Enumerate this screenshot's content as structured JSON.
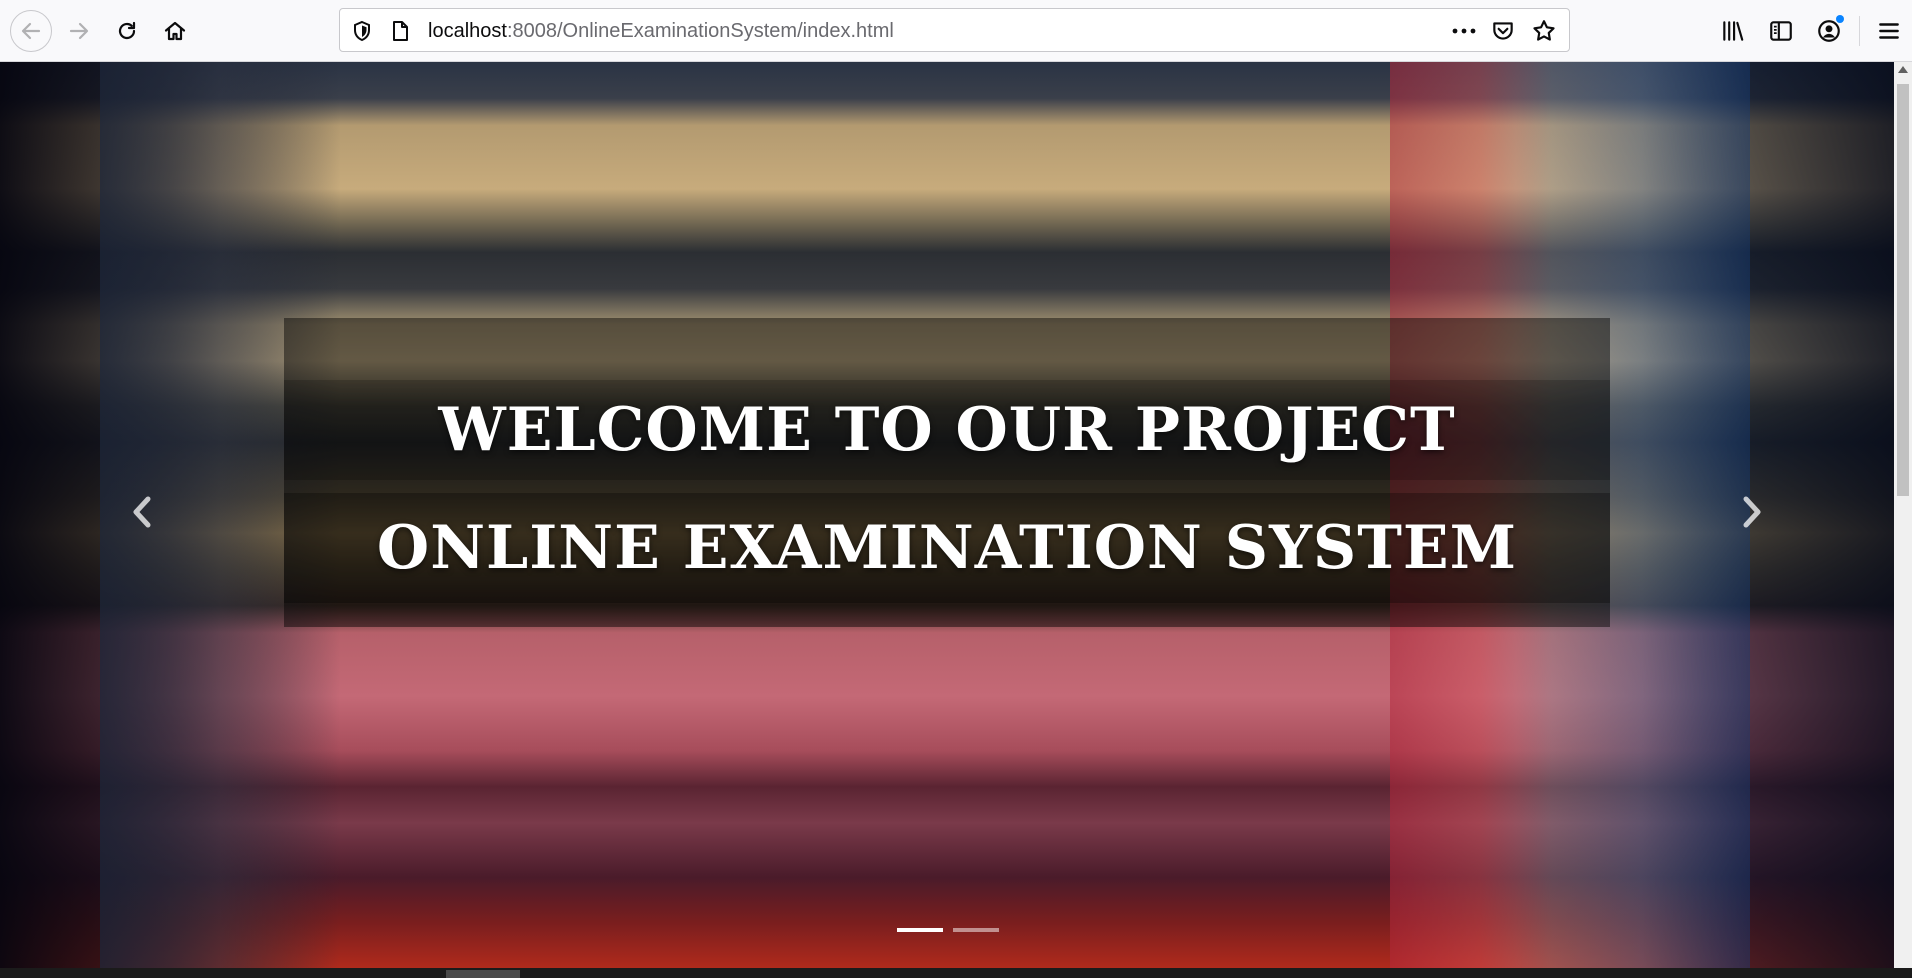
{
  "browser": {
    "url_host": "localhost",
    "url_rest": ":8008/OnlineExaminationSystem/index.html",
    "icons": {
      "back": "arrow-left-icon",
      "forward": "arrow-right-icon",
      "reload": "reload-icon",
      "home": "home-icon",
      "site_info": "shield-icon",
      "page": "page-icon",
      "page_actions": "more-dots-icon",
      "pocket": "pocket-icon",
      "bookmark": "star-icon",
      "library": "library-icon",
      "sidebar": "sidebar-icon",
      "account": "account-icon",
      "menu": "hamburger-menu-icon"
    },
    "accent_color": "#0a84ff"
  },
  "carousel": {
    "caption_line_1": "WELCOME TO OUR PROJECT",
    "caption_line_2": "ONLINE EXAMINATION SYSTEM",
    "slide_count": 2,
    "active_slide": 1,
    "prev_icon": "chevron-left-icon",
    "next_icon": "chevron-right-icon"
  }
}
